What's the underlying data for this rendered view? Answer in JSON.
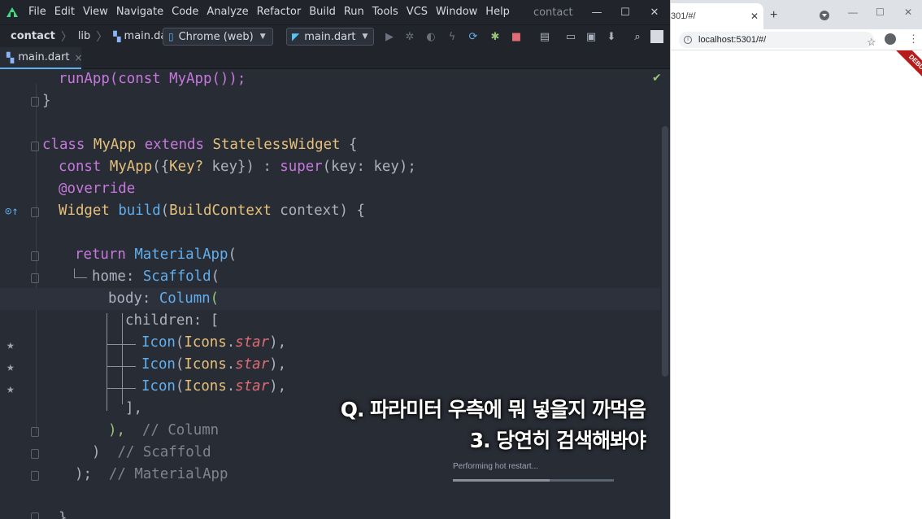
{
  "ide": {
    "menu": [
      "File",
      "Edit",
      "View",
      "Navigate",
      "Code",
      "Analyze",
      "Refactor",
      "Build",
      "Run",
      "Tools",
      "VCS",
      "Window",
      "Help"
    ],
    "project_title": "contact",
    "window_controls": {
      "minimize": "—",
      "maximize": "☐",
      "close": "✕"
    },
    "breadcrumb": [
      "contact",
      "lib",
      "main.dart"
    ],
    "device_selector": "Chrome (web)",
    "run_config": "main.dart",
    "tab": {
      "label": "main.dart",
      "close": "×"
    },
    "code": {
      "l1": "runApp(const MyApp());",
      "l2": "}",
      "l4_kw1": "class",
      "l4_cls": "MyApp",
      "l4_kw2": "extends",
      "l4_cls2": "StatelessWidget",
      "l4_end": " {",
      "l5_kw": "const",
      "l5_cls": "MyApp",
      "l5_a": "({",
      "l5_type": "Key?",
      "l5_b": " key}) : ",
      "l5_super": "super",
      "l5_c": "(key: key);",
      "l6": "@override",
      "l7_type": "Widget",
      "l7_fn": "build",
      "l7_a": "(",
      "l7_type2": "BuildContext",
      "l7_b": " context) {",
      "l9_kw": "return",
      "l9_cls": "MaterialApp",
      "l9_end": "(",
      "l10_a": "home: ",
      "l10_cls": "Scaffold",
      "l10_end": "(",
      "l11_a": "body: ",
      "l11_cls": "Column",
      "l11_end": "(",
      "l12": "children: [",
      "icon_cls": "Icon",
      "icons_cls": "Icons",
      "star": "star",
      "l16": "],",
      "l17_a": "),",
      "l17_cmt": "// Column",
      "l18_a": ")",
      "l18_cmt": "// Scaffold",
      "l19_a": ");",
      "l19_cmt": "// MaterialApp",
      "l20": "}"
    },
    "subtitle_line1": "Q. 파라미터 우측에 뭐 넣을지 까먹음",
    "subtitle_line2": "3. 당연히 검색해봐야",
    "status_text": "Performing hot restart...",
    "hot_restart_progress": 0.6
  },
  "browser": {
    "tab_title": "301/#/",
    "tab_close": "✕",
    "new_tab": "+",
    "window_controls": {
      "minimize": "—",
      "maximize": "☐",
      "close": "✕"
    },
    "url": "localhost:5301/#/",
    "debug_banner": "DEBUG",
    "menu_dots": "⋮"
  }
}
